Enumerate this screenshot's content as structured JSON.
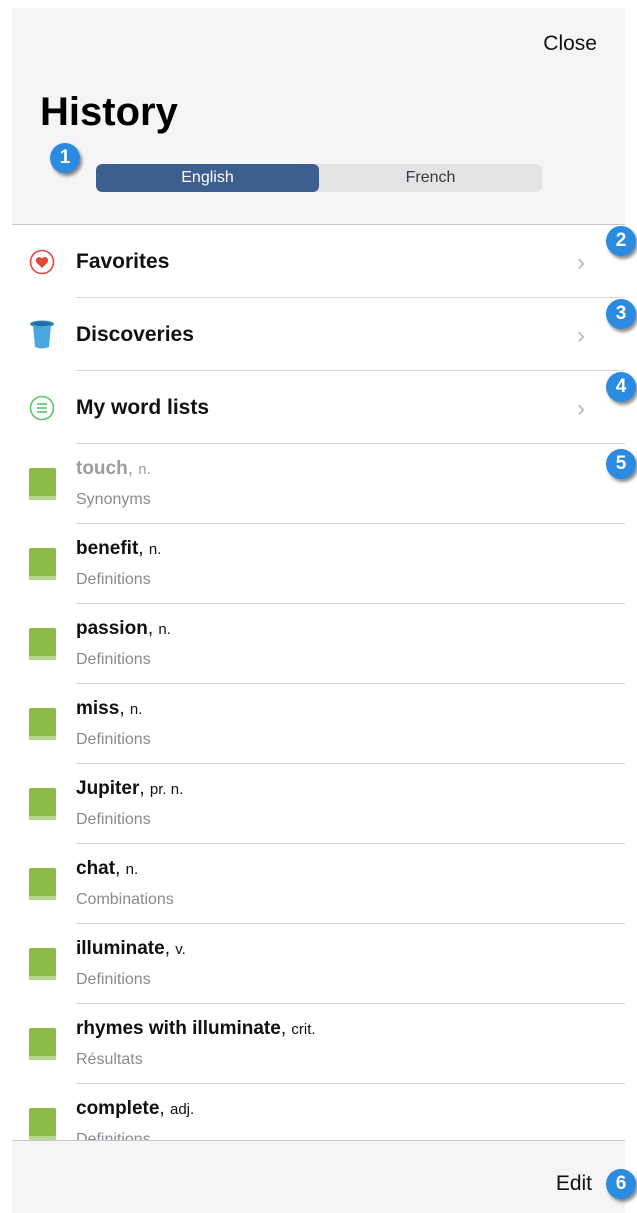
{
  "header": {
    "close_label": "Close",
    "title": "History",
    "segments": [
      {
        "label": "English",
        "active": true
      },
      {
        "label": "French",
        "active": false
      }
    ]
  },
  "sections": [
    {
      "label": "Favorites",
      "icon": "heart-icon"
    },
    {
      "label": "Discoveries",
      "icon": "top-hat-icon"
    },
    {
      "label": "My word lists",
      "icon": "list-icon"
    }
  ],
  "history": [
    {
      "word": "touch",
      "pos": "n.",
      "sub": "Synonyms"
    },
    {
      "word": "benefit",
      "pos": "n.",
      "sub": "Definitions"
    },
    {
      "word": "passion",
      "pos": "n.",
      "sub": "Definitions"
    },
    {
      "word": "miss",
      "pos": "n.",
      "sub": "Definitions"
    },
    {
      "word": "Jupiter",
      "pos": "pr. n.",
      "sub": "Definitions"
    },
    {
      "word": "chat",
      "pos": "n.",
      "sub": "Combinations"
    },
    {
      "word": "illuminate",
      "pos": "v.",
      "sub": "Definitions"
    },
    {
      "word": "rhymes with illuminate",
      "pos": "crit.",
      "sub": "Résultats"
    },
    {
      "word": "complete",
      "pos": "adj.",
      "sub": "Definitions"
    }
  ],
  "footer": {
    "edit_label": "Edit"
  },
  "annotations": [
    "1",
    "2",
    "3",
    "4",
    "5",
    "6"
  ],
  "colors": {
    "segment_active": "#3d5f8e",
    "badge": "#2b8be0",
    "heart": "#e8453c",
    "hat": "#4aa8e0",
    "list_icon": "#5cc46b",
    "book": "#8cbb4a"
  }
}
